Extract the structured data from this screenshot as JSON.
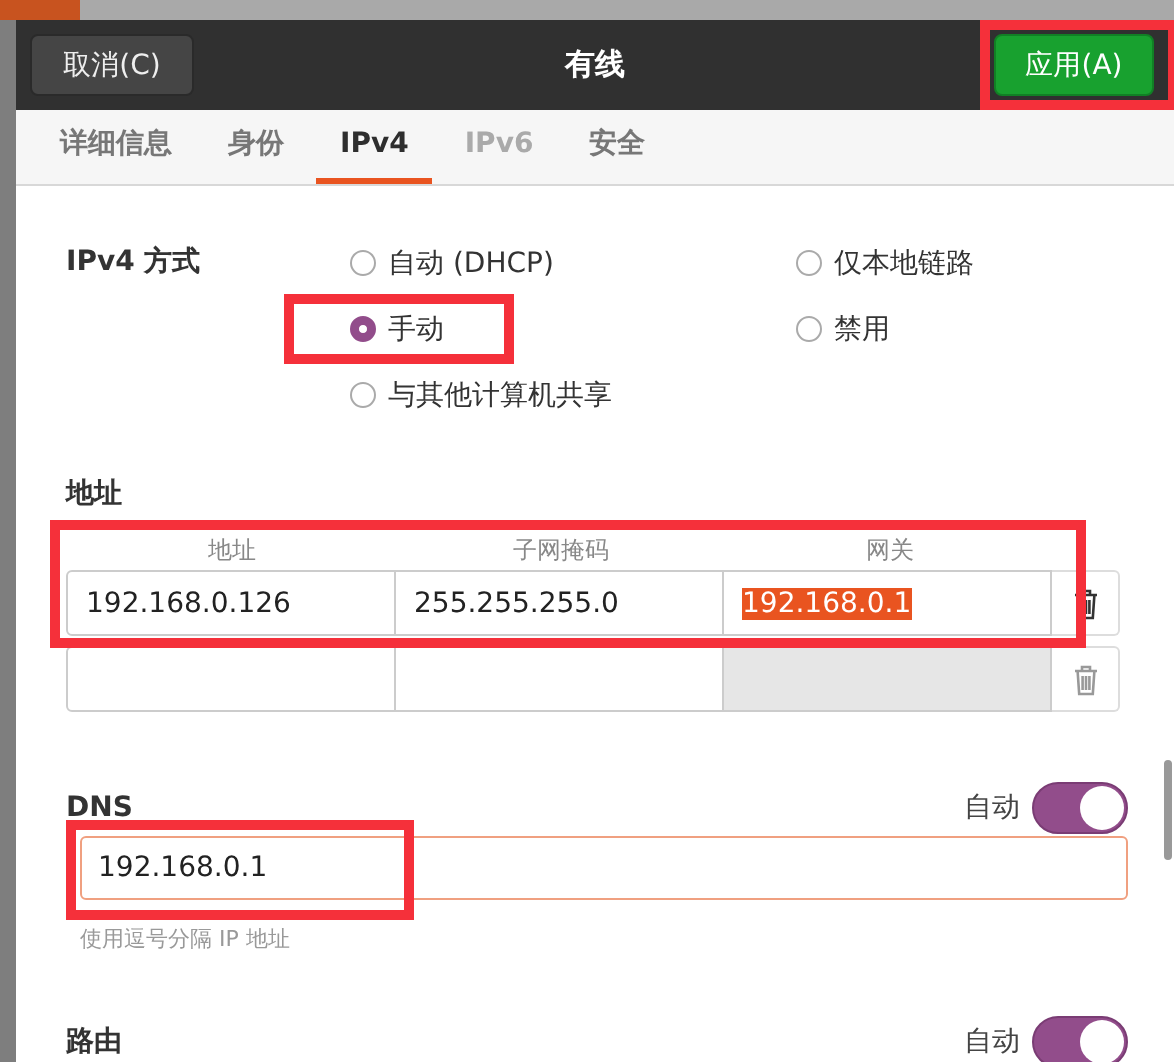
{
  "header": {
    "cancel_button": "取消(C)",
    "title": "有线",
    "apply_button": "应用(A)",
    "apply_marked": true
  },
  "tabs": [
    {
      "label": "详细信息",
      "selected": false,
      "disabled": false
    },
    {
      "label": "身份",
      "selected": false,
      "disabled": false
    },
    {
      "label": "IPv4",
      "selected": true,
      "disabled": false
    },
    {
      "label": "IPv6",
      "selected": false,
      "disabled": true
    },
    {
      "label": "安全",
      "selected": false,
      "disabled": false
    }
  ],
  "ipv4_method": {
    "label": "IPv4 方式",
    "columns": [
      [
        {
          "label": "自动 (DHCP)",
          "selected": false,
          "marked": false
        },
        {
          "label": "手动",
          "selected": true,
          "marked": true
        },
        {
          "label": "与其他计算机共享",
          "selected": false,
          "marked": false
        }
      ],
      [
        {
          "label": "仅本地链路",
          "selected": false,
          "marked": false
        },
        {
          "label": "禁用",
          "selected": false,
          "marked": false
        }
      ]
    ]
  },
  "addresses": {
    "title": "地址",
    "marked": true,
    "columns": [
      "地址",
      "子网掩码",
      "网关"
    ],
    "rows": [
      {
        "cells": [
          {
            "value": "192.168.0.126",
            "highlighted": false,
            "disabled": false
          },
          {
            "value": "255.255.255.0",
            "highlighted": false,
            "disabled": false
          },
          {
            "value": "192.168.0.1",
            "highlighted": true,
            "disabled": false
          }
        ]
      },
      {
        "cells": [
          {
            "disabled": false
          },
          {
            "disabled": false
          },
          {
            "disabled": true
          }
        ]
      }
    ]
  },
  "dns": {
    "title": "DNS",
    "auto_label": "自动",
    "auto": true,
    "value": "192.168.0.1",
    "focused": true,
    "marked": true,
    "hint": "使用逗号分隔 IP 地址"
  },
  "routes": {
    "title": "路由",
    "auto_label": "自动",
    "auto": true
  }
}
